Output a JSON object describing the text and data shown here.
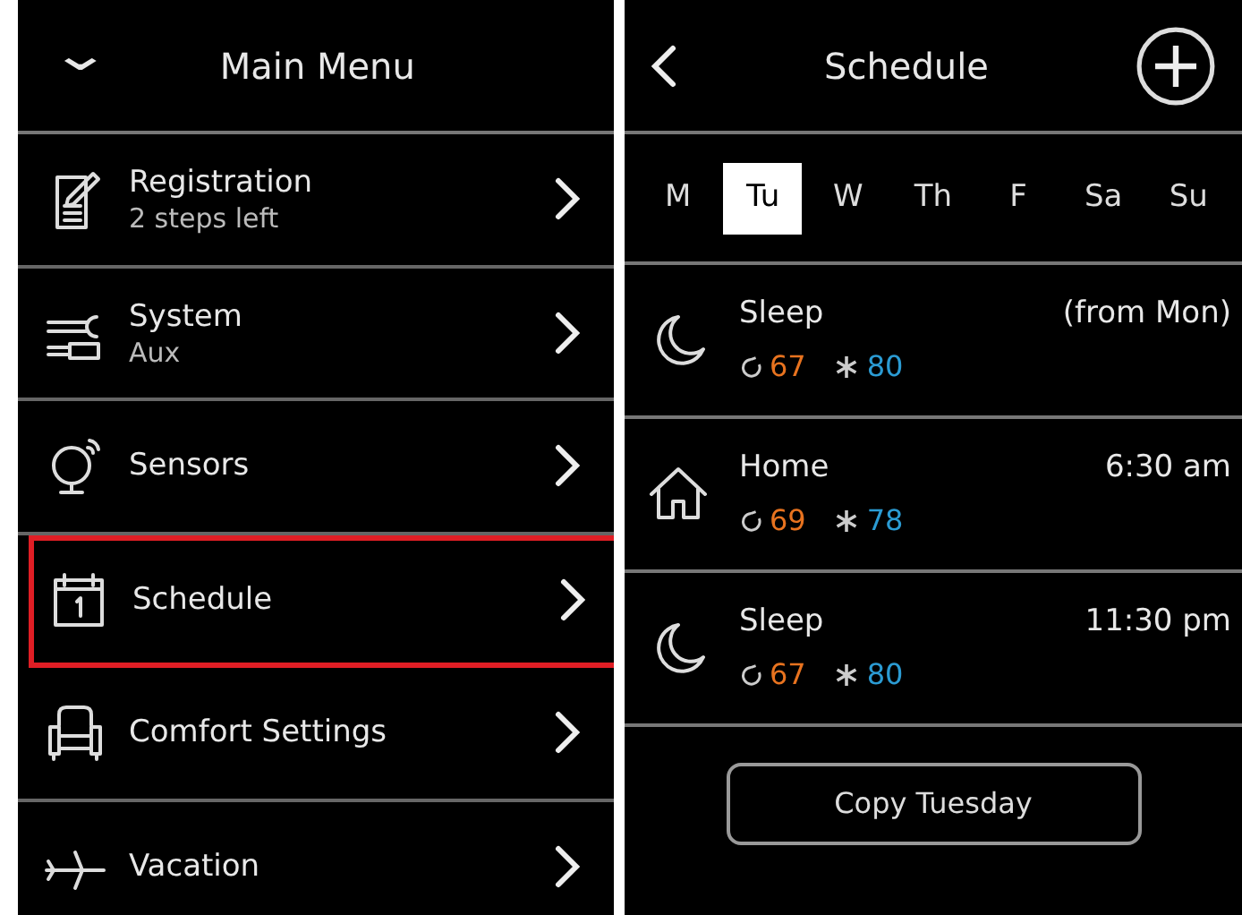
{
  "main_menu": {
    "collapse_icon": "⌄",
    "title": "Main Menu",
    "items": [
      {
        "kind": "registration",
        "title": "Registration",
        "subtitle": "2 steps left",
        "highlighted": false
      },
      {
        "kind": "system",
        "title": "System",
        "subtitle": "Aux",
        "highlighted": false
      },
      {
        "kind": "sensors",
        "title": "Sensors",
        "highlighted": false
      },
      {
        "kind": "calendar",
        "title": "Schedule",
        "highlighted": true
      },
      {
        "kind": "comfort",
        "title": "Comfort Settings",
        "highlighted": false
      },
      {
        "kind": "vacation",
        "title": "Vacation",
        "highlighted": false
      }
    ]
  },
  "schedule": {
    "title": "Schedule",
    "days": [
      {
        "label": "M",
        "selected": false
      },
      {
        "label": "Tu",
        "selected": true
      },
      {
        "label": "W",
        "selected": false
      },
      {
        "label": "Th",
        "selected": false
      },
      {
        "label": "F",
        "selected": false
      },
      {
        "label": "Sa",
        "selected": false
      },
      {
        "label": "Su",
        "selected": false
      }
    ],
    "periods": [
      {
        "kind": "sleep",
        "name": "Sleep",
        "time": "(from Mon)",
        "heat": "67",
        "cool": "80"
      },
      {
        "kind": "home",
        "name": "Home",
        "time": "6:30 am",
        "heat": "69",
        "cool": "78"
      },
      {
        "kind": "sleep",
        "name": "Sleep",
        "time": "11:30 pm",
        "heat": "67",
        "cool": "80"
      }
    ],
    "copy_button": "Copy Tuesday"
  }
}
